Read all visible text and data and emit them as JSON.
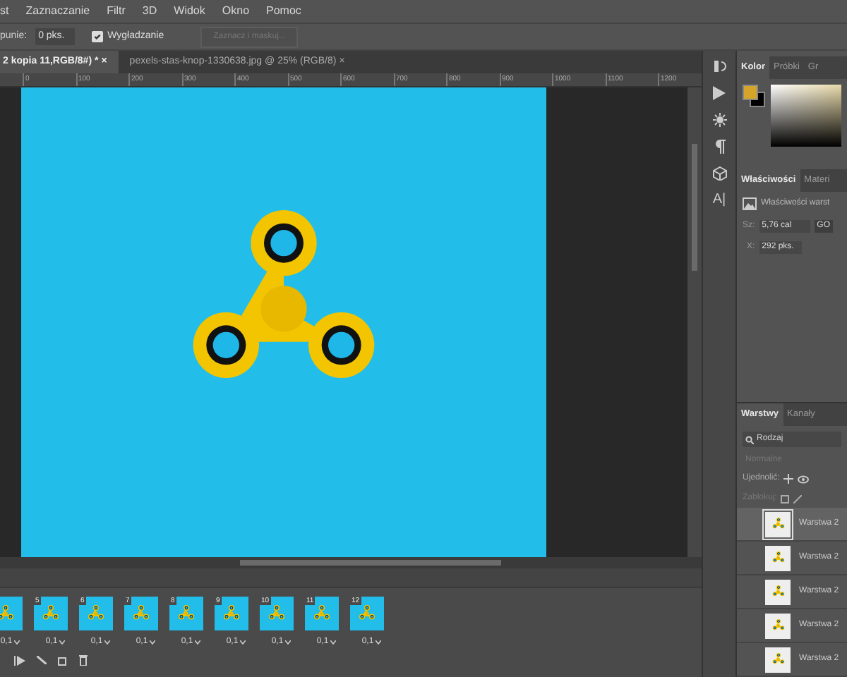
{
  "menu": [
    "st",
    "Zaznaczanie",
    "Filtr",
    "3D",
    "Widok",
    "Okno",
    "Pomoc"
  ],
  "options": {
    "label": "punie:",
    "value": "0 pks.",
    "smoothing": {
      "label": "Wygładzanie",
      "checked": true
    },
    "mask_button": {
      "label": "Zaznacz i maskuj...",
      "disabled": true
    }
  },
  "tabs": [
    {
      "label": "2 kopia 11,RGB/8#) *",
      "close": "×",
      "selected": true
    },
    {
      "label": "pexels-stas-knop-1330638.jpg @ 25% (RGB/8)",
      "close": "×",
      "selected": false
    }
  ],
  "ruler": [
    "0",
    "100",
    "200",
    "300",
    "400",
    "500",
    "600",
    "700",
    "800",
    "900",
    "1000",
    "1100",
    "1200"
  ],
  "timeline": {
    "frames": [
      {
        "delay": "0,1"
      },
      {
        "number": "5",
        "delay": "0,1"
      },
      {
        "number": "6",
        "delay": "0,1"
      },
      {
        "number": "7",
        "delay": "0,1"
      },
      {
        "number": "8",
        "delay": "0,1"
      },
      {
        "number": "9",
        "delay": "0,1"
      },
      {
        "number": "10",
        "delay": "0,1"
      },
      {
        "number": "11",
        "delay": "0,1"
      },
      {
        "number": "12",
        "delay": "0,1"
      }
    ]
  },
  "color_panel": {
    "tabs": [
      {
        "label": "Kolor",
        "selected": true
      },
      {
        "label": "Próbki",
        "selected": false
      },
      {
        "label": "Gr",
        "selected": false
      }
    ],
    "tool_strip_text_icon": "A|"
  },
  "properties_panel": {
    "tabs": [
      {
        "label": "Właściwości",
        "selected": true
      },
      {
        "label": "Materi",
        "selected": false
      }
    ],
    "title": "Właściwości warst",
    "width_label": "Sz:",
    "width_value": "5,76 cal",
    "link": "GO",
    "x_label": "X:",
    "x_value": "292 pks."
  },
  "layers_panel": {
    "tabs": [
      {
        "label": "Warstwy",
        "selected": true
      },
      {
        "label": "Kanały",
        "selected": false
      }
    ],
    "filter": "Rodzaj",
    "blend_mode": "Normalne",
    "unify_label": "Ujednolić:",
    "lock_label": "Zablokuj:",
    "layers": [
      {
        "name": "Warstwa 2",
        "selected": true
      },
      {
        "name": "Warstwa 2",
        "selected": false
      },
      {
        "name": "Warstwa 2",
        "selected": false
      },
      {
        "name": "Warstwa 2",
        "selected": false
      },
      {
        "name": "Warstwa 2",
        "selected": false
      }
    ]
  }
}
